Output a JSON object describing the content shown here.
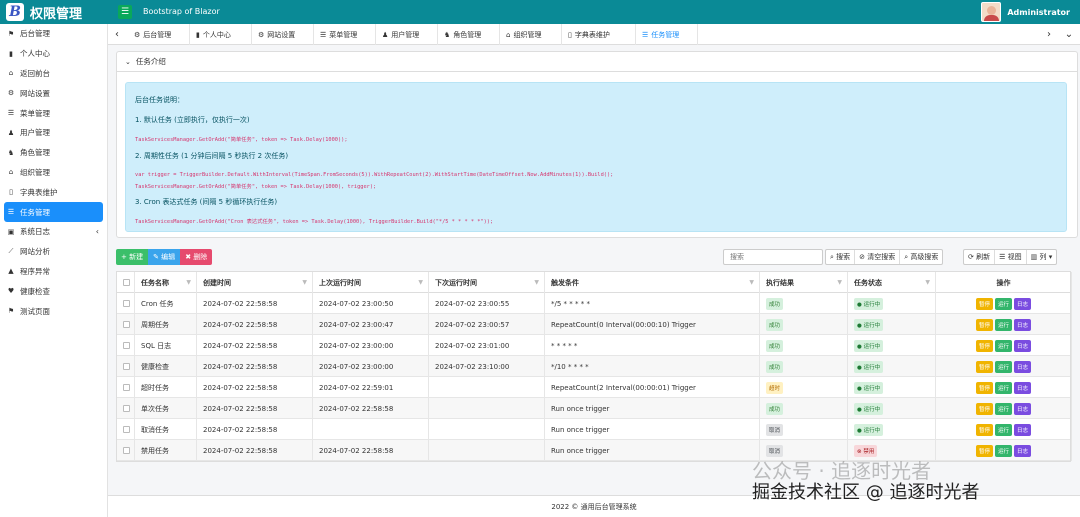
{
  "app": {
    "brand": "权限管理",
    "subtitle": "Bootstrap of Blazor",
    "user": "Administrator",
    "logo": "B"
  },
  "sidebar": [
    {
      "label": "后台管理",
      "icon": "⚑"
    },
    {
      "label": "个人中心",
      "icon": "▮"
    },
    {
      "label": "返回前台",
      "icon": "⌂"
    },
    {
      "label": "网站设置",
      "icon": "⚙"
    },
    {
      "label": "菜单管理",
      "icon": "☰"
    },
    {
      "label": "用户管理",
      "icon": "♟"
    },
    {
      "label": "角色管理",
      "icon": "♞"
    },
    {
      "label": "组织管理",
      "icon": "⌂"
    },
    {
      "label": "字典表维护",
      "icon": "▯"
    },
    {
      "label": "任务管理",
      "icon": "☰"
    },
    {
      "label": "系统日志",
      "icon": "▣"
    },
    {
      "label": "网站分析",
      "icon": "⟋"
    },
    {
      "label": "程序异常",
      "icon": "▲"
    },
    {
      "label": "健康检查",
      "icon": "♥"
    },
    {
      "label": "测试页面",
      "icon": "⚑"
    }
  ],
  "tabs": [
    {
      "label": "后台管理",
      "icon": "⚙"
    },
    {
      "label": "个人中心",
      "icon": "▮"
    },
    {
      "label": "网站设置",
      "icon": "⚙"
    },
    {
      "label": "菜单管理",
      "icon": "☰"
    },
    {
      "label": "用户管理",
      "icon": "♟"
    },
    {
      "label": "角色管理",
      "icon": "♞"
    },
    {
      "label": "组织管理",
      "icon": "⌂"
    },
    {
      "label": "字典表维护",
      "icon": "▯"
    },
    {
      "label": "任务管理",
      "icon": "☰"
    }
  ],
  "intro": {
    "title": "任务介绍",
    "heading": "后台任务说明：",
    "item1": "1. 默认任务 (立即执行，仅执行一次)",
    "code1": "TaskServicesManager.GetOrAdd(\"简单任务\", token => Task.Delay(1000));",
    "item2": "2. 周期性任务 (1 分钟后间隔 5 秒执行 2 次任务)",
    "code2a": "var trigger = TriggerBuilder.Default.WithInterval(TimeSpan.FromSeconds(5)).WithRepeatCount(2).WithStartTime(DateTimeOffset.Now.AddMinutes(1)).Build();",
    "code2b": "TaskServicesManager.GetOrAdd(\"简单任务\", token => Task.Delay(1000), trigger);",
    "item3": "3. Cron 表达式任务 (间隔 5 秒循环执行任务)",
    "code3": "TaskServicesManager.GetOrAdd(\"Cron 表达式任务\", token => Task.Delay(1000), TriggerBuilder.Build(\"*/5 * * * * *\"));"
  },
  "toolbar": {
    "add": "+ 新建",
    "edit": "✎ 编辑",
    "del": "✖ 删除",
    "search_placeholder": "搜索",
    "search": "搜索",
    "clear": "清空搜索",
    "advanced": "高级搜索",
    "refresh": "刷新",
    "view": "视图",
    "cols": "列"
  },
  "table": {
    "headers": [
      "任务名称",
      "创建时间",
      "上次运行时间",
      "下次运行时间",
      "触发条件",
      "执行结果",
      "任务状态",
      "操作"
    ],
    "ops": [
      "暂停",
      "运行",
      "日志"
    ],
    "rows": [
      {
        "name": "Cron 任务",
        "created": "2024-07-02 22:58:58",
        "last": "2024-07-02 23:00:50",
        "next": "2024-07-02 23:00:55",
        "trigger": "*/5 * * * * *",
        "result": "成功",
        "rclass": "b-ok",
        "status": "运行中",
        "sclass": "b-run"
      },
      {
        "name": "周期任务",
        "created": "2024-07-02 22:58:58",
        "last": "2024-07-02 23:00:47",
        "next": "2024-07-02 23:00:57",
        "trigger": "RepeatCount(0 Interval(00:00:10) Trigger",
        "result": "成功",
        "rclass": "b-ok",
        "status": "运行中",
        "sclass": "b-run"
      },
      {
        "name": "SQL 日志",
        "created": "2024-07-02 22:58:58",
        "last": "2024-07-02 23:00:00",
        "next": "2024-07-02 23:01:00",
        "trigger": "* * * * *",
        "result": "成功",
        "rclass": "b-ok",
        "status": "运行中",
        "sclass": "b-run"
      },
      {
        "name": "健康检查",
        "created": "2024-07-02 22:58:58",
        "last": "2024-07-02 23:00:00",
        "next": "2024-07-02 23:10:00",
        "trigger": "*/10 * * * *",
        "result": "成功",
        "rclass": "b-ok",
        "status": "运行中",
        "sclass": "b-run"
      },
      {
        "name": "超时任务",
        "created": "2024-07-02 22:58:58",
        "last": "2024-07-02 22:59:01",
        "next": "",
        "trigger": "RepeatCount(2 Interval(00:00:01) Trigger",
        "result": "超时",
        "rclass": "b-warn",
        "status": "运行中",
        "sclass": "b-run"
      },
      {
        "name": "单次任务",
        "created": "2024-07-02 22:58:58",
        "last": "2024-07-02 22:58:58",
        "next": "",
        "trigger": "Run once trigger",
        "result": "成功",
        "rclass": "b-ok",
        "status": "运行中",
        "sclass": "b-run"
      },
      {
        "name": "取消任务",
        "created": "2024-07-02 22:58:58",
        "last": "",
        "next": "",
        "trigger": "Run once trigger",
        "result": "取消",
        "rclass": "b-off",
        "status": "运行中",
        "sclass": "b-run"
      },
      {
        "name": "禁用任务",
        "created": "2024-07-02 22:58:58",
        "last": "2024-07-02 22:58:58",
        "next": "",
        "trigger": "Run once trigger",
        "result": "取消",
        "rclass": "b-off",
        "status": "禁用",
        "sclass": "b-stop"
      }
    ]
  },
  "footer": "2022 © 通用后台管理系统",
  "watermark": {
    "line1": "公众号 · 追逐时光者",
    "line2": "掘金技术社区 @ 追逐时光者"
  }
}
